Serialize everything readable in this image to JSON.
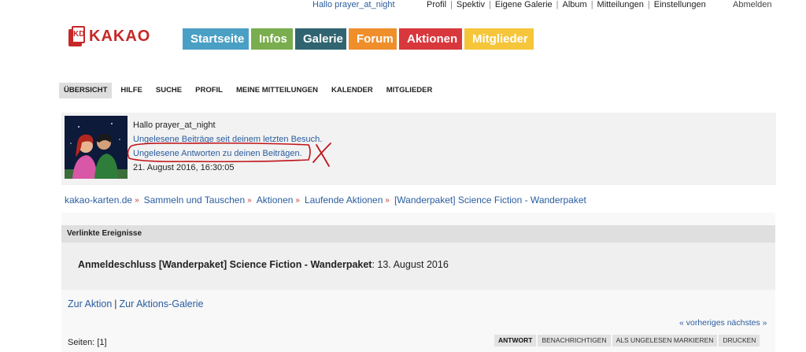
{
  "topbar": {
    "greeting": "Hallo prayer_at_night",
    "links": [
      "Profil",
      "Spektiv",
      "Eigene Galerie",
      "Album",
      "Mitteilungen",
      "Einstellungen"
    ],
    "logout": "Abmelden"
  },
  "logo": {
    "mark": "KD",
    "text": "KAKAO"
  },
  "mainnav": [
    {
      "label": "Startseite",
      "color": "#4a9fc4"
    },
    {
      "label": "Infos",
      "color": "#79ad4d"
    },
    {
      "label": "Galerie",
      "color": "#2f6470"
    },
    {
      "label": "Forum",
      "color": "#ee8f2c"
    },
    {
      "label": "Aktionen",
      "color": "#d8373c"
    },
    {
      "label": "Mitglieder",
      "color": "#f5c53a"
    }
  ],
  "subnav": [
    "Übersicht",
    "Hilfe",
    "Suche",
    "Profil",
    "Meine Mitteilungen",
    "Kalender",
    "Mitglieder"
  ],
  "userpanel": {
    "greeting": "Hallo prayer_at_night",
    "link_unread_posts": "Ungelesene Beiträge seit deinem letzten Besuch.",
    "link_unread_replies": "Ungelesene Antworten zu deinen Beiträgen.",
    "datetime": "21. August 2016, 16:30:05"
  },
  "breadcrumb": [
    "kakao-karten.de",
    "Sammeln und Tauschen",
    "Aktionen",
    "Laufende Aktionen",
    "[Wanderpaket] Science Fiction - Wanderpaket"
  ],
  "linked_events": {
    "header": "Verlinkte Ereignisse",
    "event_title": "Anmeldeschluss [Wanderpaket] Science Fiction - Wanderpaket",
    "event_date": ": 13. August 2016"
  },
  "action_links": {
    "to_action": "Zur Aktion",
    "separator": "|",
    "to_gallery": "Zur Aktions-Galerie"
  },
  "pager": {
    "prev": "« vorheriges",
    "next": "nächstes »"
  },
  "pages": {
    "label": "Seiten:",
    "current": "[1]"
  },
  "buttons": [
    "Antwort",
    "Benachrichtigen",
    "Als ungelesen markieren",
    "Drucken"
  ],
  "accent_color": "#2a5d9f",
  "annotation_color": "#c0141a"
}
